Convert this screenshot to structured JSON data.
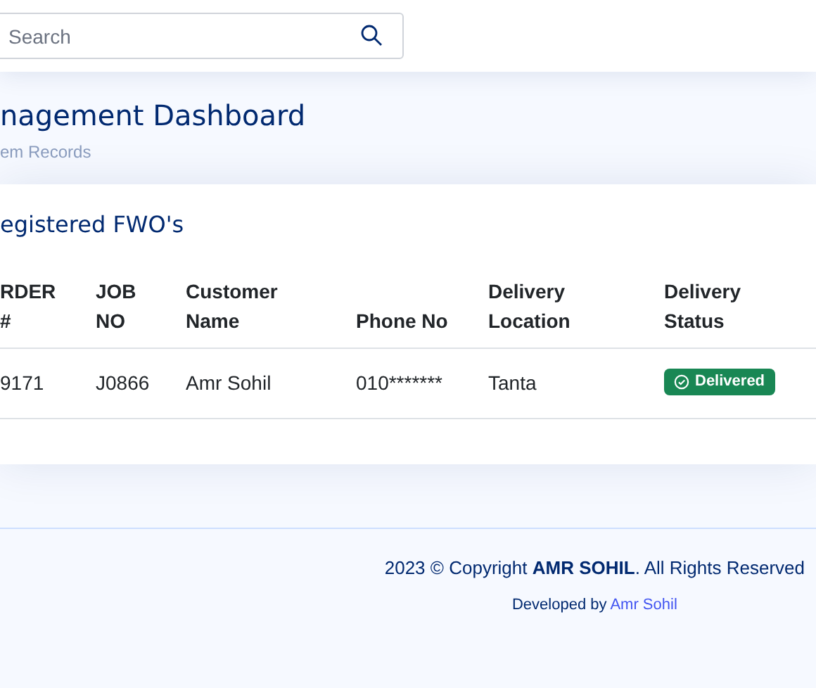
{
  "header": {
    "search": {
      "placeholder": "Search"
    }
  },
  "page_title": {
    "title": "nagement Dashboard",
    "breadcrumb": "em Records"
  },
  "card": {
    "title": "egistered FWO's",
    "table": {
      "columns": [
        "RDER\n#",
        "JOB\nNO",
        "Customer\nName",
        "Phone No",
        "Delivery\nLocation",
        "Delivery\nStatus"
      ],
      "rows": [
        {
          "cells": [
            "9171",
            "J0866",
            "Amr Sohil",
            "010*******",
            "Tanta"
          ],
          "status": {
            "label": "Delivered",
            "kind": "delivered"
          }
        }
      ]
    }
  },
  "footer": {
    "year": "2023 ©",
    "copyright_prefix": "Copyright",
    "owner": "AMR SOHIL",
    "suffix": ". All Rights Reserved",
    "developed_by": "Developed by",
    "developer": "Amr Sohil"
  }
}
